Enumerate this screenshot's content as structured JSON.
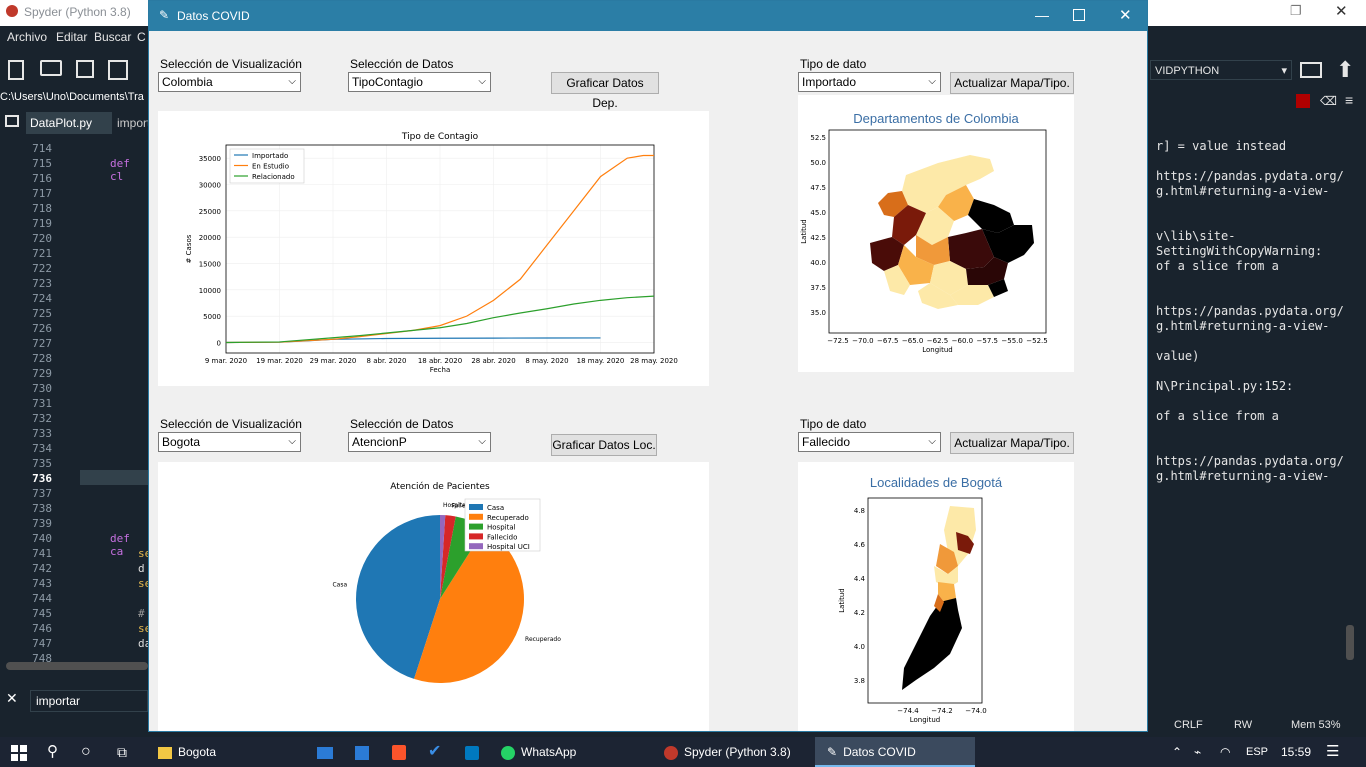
{
  "spyder": {
    "title": "Spyder (Python 3.8)",
    "menu": [
      "Archivo",
      "Editar",
      "Buscar",
      "C"
    ],
    "path": "C:\\Users\\Uno\\Documents\\Tra",
    "tabs": [
      "DataPlot.py",
      "import"
    ],
    "env_box": "VIDPYTHON",
    "line_numbers": [
      "714",
      "715",
      "716",
      "717",
      "718",
      "719",
      "720",
      "721",
      "722",
      "723",
      "724",
      "725",
      "726",
      "727",
      "728",
      "729",
      "730",
      "731",
      "732",
      "733",
      "734",
      "735",
      "736",
      "737",
      "738",
      "739",
      "740",
      "741",
      "742",
      "743",
      "744",
      "745",
      "746",
      "747",
      "748"
    ],
    "code_def1": "def cl",
    "code_def2": "def ca",
    "code_s1": "se",
    "code_d": "d",
    "code_s2": "se",
    "code_hash": "#",
    "code_s3": "se",
    "code_da": "da",
    "search_value": "importar",
    "console_lines": [
      {
        "text": "r] = value instead",
        "top": 9
      },
      {
        "text": "https://pandas.pydata.org/",
        "top": 39
      },
      {
        "text": "g.html#returning-a-view-",
        "top": 54
      },
      {
        "text": "v\\lib\\site-",
        "top": 99
      },
      {
        "text": "SettingWithCopyWarning:",
        "top": 114
      },
      {
        "text": "of a slice from a",
        "top": 129
      },
      {
        "text": "https://pandas.pydata.org/",
        "top": 174
      },
      {
        "text": "g.html#returning-a-view-",
        "top": 189
      },
      {
        "text": "value)",
        "top": 219
      },
      {
        "text": "N\\Principal.py:152:",
        "top": 249
      },
      {
        "text": "of a slice from a",
        "top": 279
      },
      {
        "text": "https://pandas.pydata.org/",
        "top": 324
      },
      {
        "text": "g.html#returning-a-view-",
        "top": 339
      }
    ],
    "status_crlf": "CRLF",
    "status_rw": "RW",
    "status_mem": "Mem 53%"
  },
  "window": {
    "title": "Datos COVID"
  },
  "top_section": {
    "vis_label": "Selección de Visualización",
    "vis_value": "Colombia",
    "data_label": "Selección de Datos",
    "data_value": "TipoContagio",
    "graph_button": "Graficar Datos Dep.",
    "type_label": "Tipo de dato",
    "type_value": "Importado",
    "update_button": "Actualizar Mapa/Tipo.",
    "map_title": "Departamentos de Colombia"
  },
  "bottom_section": {
    "vis_label": "Selección de Visualización",
    "vis_value": "Bogota",
    "data_label": "Selección de Datos",
    "data_value": "AtencionP",
    "graph_button": "Graficar Datos Loc.",
    "type_label": "Tipo de dato",
    "type_value": "Fallecido",
    "update_button": "Actualizar Mapa/Tipo.",
    "map_title": "Localidades de Bogotá"
  },
  "line_chart": {
    "type": "line",
    "title": "Tipo de Contagio",
    "xlabel": "Fecha",
    "ylabel": "# Casos",
    "ylim": [
      -2000,
      37500
    ],
    "yticks": [
      0,
      5000,
      10000,
      15000,
      20000,
      25000,
      30000,
      35000
    ],
    "x_range": [
      0,
      80
    ],
    "xtick_positions": [
      0,
      10,
      20,
      30,
      40,
      50,
      60,
      70
    ],
    "xticks": [
      "9 mar. 2020",
      "19 mar. 2020",
      "29 mar. 2020",
      "8 abr. 2020",
      "18 abr. 2020",
      "28 abr. 2020",
      "8 may. 2020",
      "18 may. 2020",
      "28 may. 2020"
    ],
    "legend_position": "upper-left",
    "series": [
      {
        "name": "Importado",
        "color": "#1f77b4",
        "x": [
          0,
          10,
          15,
          20,
          30,
          40,
          50,
          60,
          70
        ],
        "y": [
          0,
          50,
          300,
          600,
          750,
          800,
          830,
          850,
          860
        ]
      },
      {
        "name": "En Estudio",
        "color": "#ff7f0e",
        "x": [
          0,
          10,
          20,
          25,
          30,
          35,
          40,
          45,
          50,
          55,
          60,
          65,
          70,
          75,
          78,
          80
        ],
        "y": [
          0,
          50,
          600,
          1100,
          1700,
          2300,
          3200,
          5000,
          8000,
          12000,
          18500,
          25000,
          31500,
          35000,
          35500,
          35500
        ]
      },
      {
        "name": "Relacionado",
        "color": "#2ca02c",
        "x": [
          0,
          10,
          20,
          25,
          30,
          35,
          40,
          45,
          50,
          55,
          60,
          65,
          70,
          75,
          80
        ],
        "y": [
          0,
          100,
          900,
          1300,
          1800,
          2300,
          2800,
          3600,
          4700,
          5600,
          6400,
          7300,
          8000,
          8500,
          8800
        ]
      }
    ]
  },
  "pie_chart": {
    "type": "pie",
    "title": "Atención de Pacientes",
    "legend_position": "upper-right",
    "slices": [
      {
        "label": "Casa",
        "value": 0.45,
        "color": "#1f77b4"
      },
      {
        "label": "Recuperado",
        "value": 0.46,
        "color": "#ff7f0e"
      },
      {
        "label": "Hospital",
        "value": 0.06,
        "color": "#2ca02c"
      },
      {
        "label": "Fallecido",
        "value": 0.02,
        "color": "#d62728"
      },
      {
        "label": "Hospital UCI",
        "value": 0.01,
        "color": "#9467bd"
      }
    ]
  },
  "map1": {
    "xlabel": "Longitud",
    "ylabel": "Latitud",
    "xticks": [
      "−72.5",
      "−70.0",
      "−67.5",
      "−65.0",
      "−62.5",
      "−60.0",
      "−57.5",
      "−55.0",
      "−52.5"
    ],
    "yticks": [
      "52.5",
      "50.0",
      "47.5",
      "45.0",
      "42.5",
      "40.0",
      "37.5",
      "35.0"
    ]
  },
  "map2": {
    "xlabel": "Longitud",
    "ylabel": "Latitud",
    "xticks": [
      "−74.4",
      "−74.2",
      "−74.0"
    ],
    "yticks": [
      "4.8",
      "4.6",
      "4.4",
      "4.2",
      "4.0",
      "3.8"
    ]
  },
  "taskbar": {
    "items": [
      "Bogota",
      "WhatsApp",
      "Spyder (Python 3.8)",
      "Datos COVID"
    ],
    "lang": "ESP",
    "time": "15:59"
  }
}
